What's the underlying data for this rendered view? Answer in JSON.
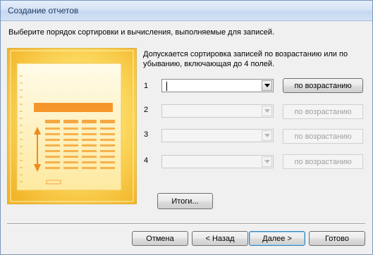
{
  "window": {
    "title": "Создание отчетов"
  },
  "instruction": "Выберите порядок сортировки и вычисления, выполняемые для записей.",
  "description": "Допускается сортировка записей по возрастанию или по убыванию, включающая до 4 полей.",
  "sort_rows": [
    {
      "number": "1",
      "value": "",
      "order_label": "по возрастанию",
      "enabled": true
    },
    {
      "number": "2",
      "value": "",
      "order_label": "по возрастанию",
      "enabled": false
    },
    {
      "number": "3",
      "value": "",
      "order_label": "по возрастанию",
      "enabled": false
    },
    {
      "number": "4",
      "value": "",
      "order_label": "по возрастанию",
      "enabled": false
    }
  ],
  "summary_button": "Итоги...",
  "footer": {
    "cancel": "Отмена",
    "back": "< Назад",
    "next": "Далее >",
    "finish": "Готово"
  },
  "colors": {
    "illustration_bg": "#f7c23a",
    "illustration_accent": "#f08a1e",
    "title_text": "#1f3b66"
  }
}
